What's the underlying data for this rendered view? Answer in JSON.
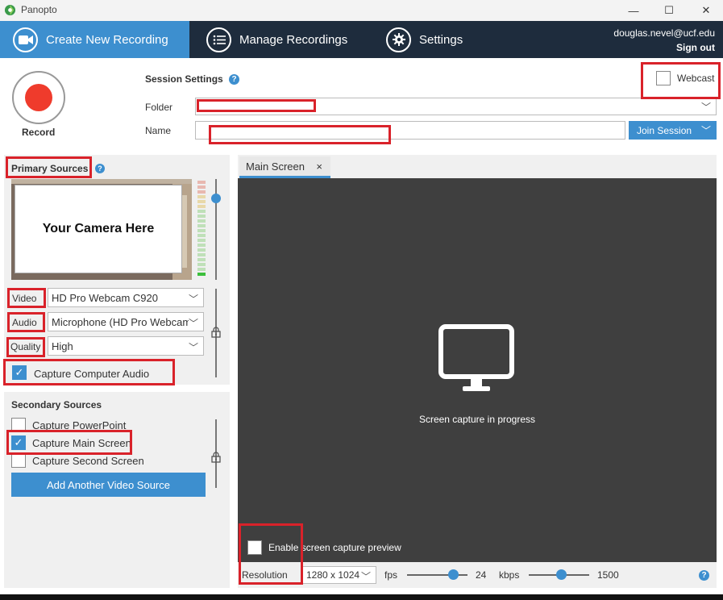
{
  "window": {
    "title": "Panopto",
    "minimize": "—",
    "maximize": "☐",
    "close": "✕"
  },
  "nav": {
    "tabs": [
      {
        "label": "Create New Recording",
        "active": true
      },
      {
        "label": "Manage Recordings",
        "active": false
      },
      {
        "label": "Settings",
        "active": false
      }
    ],
    "user_email": "douglas.nevel@ucf.edu",
    "sign_out": "Sign out"
  },
  "record": {
    "label": "Record"
  },
  "session": {
    "title": "Session Settings",
    "help": "?",
    "folder_label": "Folder",
    "folder_value": "",
    "name_label": "Name",
    "name_value": "",
    "join_label": "Join Session",
    "webcast_label": "Webcast",
    "webcast_checked": false
  },
  "primary": {
    "title": "Primary Sources",
    "help": "?",
    "camera_text": "Your Camera Here",
    "video_label": "Video",
    "video_value": "HD Pro Webcam C920",
    "audio_label": "Audio",
    "audio_value": "Microphone (HD Pro Webcam",
    "quality_label": "Quality",
    "quality_value": "High",
    "capture_audio_label": "Capture Computer Audio",
    "capture_audio_checked": true
  },
  "secondary": {
    "title": "Secondary Sources",
    "items": [
      {
        "label": "Capture PowerPoint",
        "checked": false
      },
      {
        "label": "Capture Main Screen",
        "checked": true
      },
      {
        "label": "Capture Second Screen",
        "checked": false
      }
    ],
    "add_button": "Add Another Video Source"
  },
  "preview": {
    "tab_label": "Main Screen",
    "tab_close": "×",
    "message": "Screen capture in progress",
    "enable_preview_label": "Enable screen capture preview",
    "enable_preview_checked": false
  },
  "bottom": {
    "resolution_label": "Resolution",
    "resolution_value": "1280 x 1024",
    "fps_label": "fps",
    "fps_value": "24",
    "kbps_label": "kbps",
    "kbps_value": "1500",
    "help": "?"
  },
  "colors": {
    "accent": "#3d8fcf",
    "nav_bg": "#1e2c3d",
    "record": "#ef3b2c",
    "annotation": "#d9222a",
    "preview_bg": "#3f3f3f"
  }
}
